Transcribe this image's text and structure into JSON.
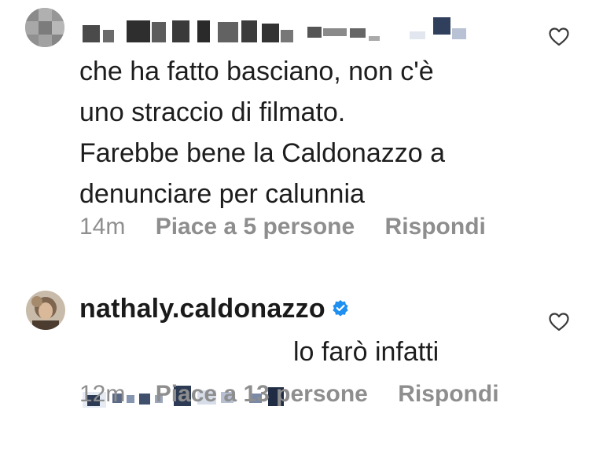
{
  "comments": [
    {
      "username": "",
      "text": "che ha fatto basciano, non c'è\nuno straccio di filmato.\nFarebbe bene la Caldonazzo a\ndenunciare per calunnia",
      "time": "14m",
      "likes": "Piace a 5 persone",
      "reply": "Rispondi"
    },
    {
      "username": "nathaly.caldonazzo",
      "verified": true,
      "text": "lo farò infatti",
      "time": "12m",
      "likes": "Piace a 13 persone",
      "reply": "Rispondi"
    }
  ],
  "colors": {
    "verified_badge": "#1f8ff0",
    "meta_text": "#8e8e8e",
    "heart_stroke": "#3a3a3a"
  },
  "icons": [
    "heart-icon",
    "verified-badge-icon"
  ]
}
